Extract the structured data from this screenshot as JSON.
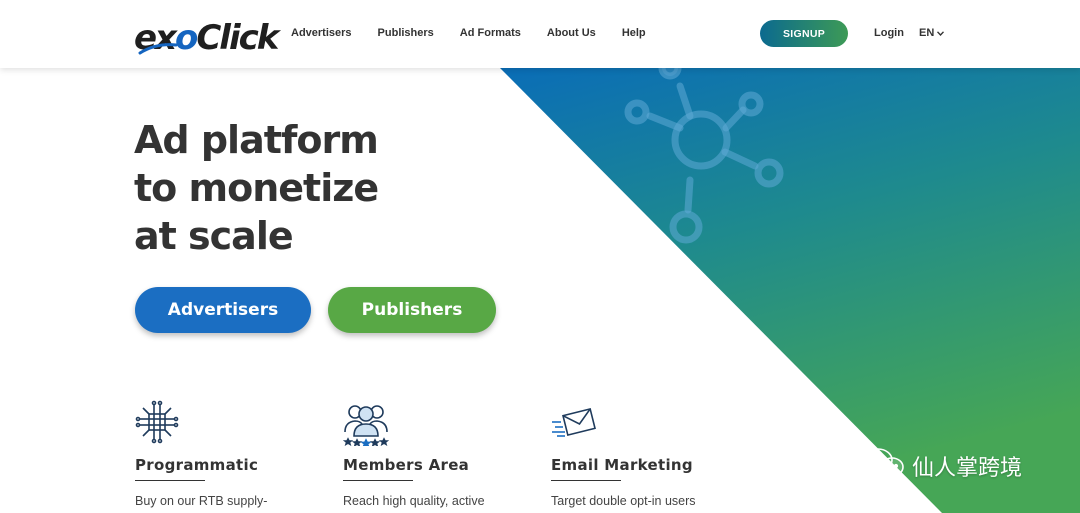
{
  "brand": {
    "logo_prefix": "ex",
    "logo_o": "o",
    "logo_suffix": "Click",
    "accent_blue": "#1b6ec2",
    "accent_green": "#58a845"
  },
  "header": {
    "nav": [
      "Advertisers",
      "Publishers",
      "Ad Formats",
      "About Us",
      "Help"
    ],
    "signup_label": "SIGNUP",
    "login_label": "Login",
    "language": "EN",
    "language_icon": "chevron-down-icon"
  },
  "hero": {
    "title_lines": [
      "Ad platform",
      "to monetize",
      "at scale"
    ],
    "cta_advertisers": "Advertisers",
    "cta_publishers": "Publishers",
    "illustration_icon": "network-hub-icon"
  },
  "features": [
    {
      "icon": "chip-icon",
      "title": "Programmatic",
      "desc": "Buy on our RTB supply-"
    },
    {
      "icon": "users-group-icon",
      "title": "Members Area",
      "desc": "Reach high quality, active"
    },
    {
      "icon": "envelope-icon",
      "title": "Email Marketing",
      "desc": "Target double opt-in users"
    }
  ],
  "watermark": {
    "icon": "wechat-icon",
    "text": "仙人掌跨境"
  }
}
